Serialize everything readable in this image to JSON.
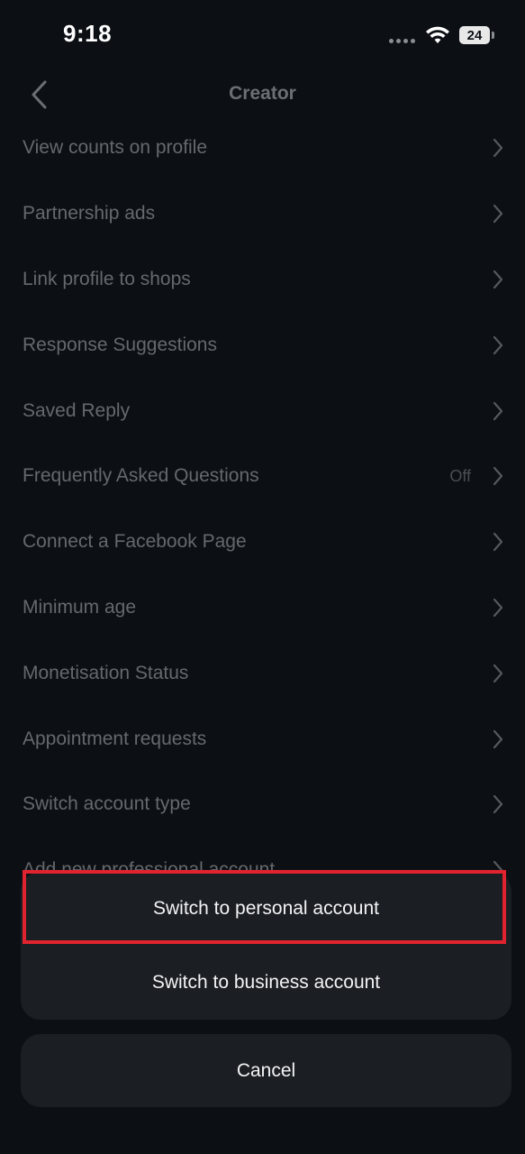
{
  "status_bar": {
    "time": "9:18",
    "battery": "24"
  },
  "header": {
    "title": "Creator",
    "back_icon": "chevron-left-icon"
  },
  "settings": {
    "items": [
      {
        "label": "View counts on profile",
        "value": ""
      },
      {
        "label": "Partnership ads",
        "value": ""
      },
      {
        "label": "Link profile to shops",
        "value": ""
      },
      {
        "label": "Response Suggestions",
        "value": ""
      },
      {
        "label": "Saved Reply",
        "value": ""
      },
      {
        "label": "Frequently Asked Questions",
        "value": "Off"
      },
      {
        "label": "Connect a Facebook Page",
        "value": ""
      },
      {
        "label": "Minimum age",
        "value": ""
      },
      {
        "label": "Monetisation Status",
        "value": ""
      },
      {
        "label": "Appointment requests",
        "value": ""
      },
      {
        "label": "Switch account type",
        "value": ""
      },
      {
        "label": "Add new professional account",
        "value": ""
      }
    ]
  },
  "action_sheet": {
    "switch_personal": "Switch to personal account",
    "switch_business": "Switch to business account",
    "cancel": "Cancel"
  },
  "colors": {
    "background": "#0c1014",
    "sheet": "#1b1f23",
    "highlight": "#e0232e"
  }
}
